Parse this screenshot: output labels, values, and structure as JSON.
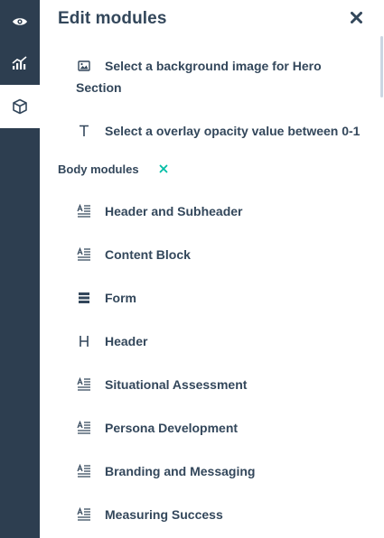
{
  "rail": {
    "items": [
      {
        "icon": "eye-icon",
        "active": false
      },
      {
        "icon": "chart-icon",
        "active": false
      },
      {
        "icon": "module-box-icon",
        "active": true
      }
    ]
  },
  "panel": {
    "title": "Edit modules",
    "close_icon": "close-icon"
  },
  "top_modules": [
    {
      "icon": "image-icon",
      "label_line1": "Select a background image for Hero",
      "label_line2": "Section"
    },
    {
      "icon": "text-icon",
      "label": "Select a overlay opacity value between 0-1"
    }
  ],
  "body_section": {
    "title": "Body modules",
    "action_icon": "collapse-x-icon",
    "accent": "#00bda5"
  },
  "body_modules": [
    {
      "icon": "rich-text-icon",
      "label": "Header and Subheader"
    },
    {
      "icon": "rich-text-icon",
      "label": "Content Block"
    },
    {
      "icon": "form-icon",
      "label": "Form"
    },
    {
      "icon": "header-icon",
      "label": "Header"
    },
    {
      "icon": "rich-text-icon",
      "label": "Situational Assessment"
    },
    {
      "icon": "rich-text-icon",
      "label": "Persona Development"
    },
    {
      "icon": "rich-text-icon",
      "label": "Branding and Messaging"
    },
    {
      "icon": "rich-text-icon",
      "label": "Measuring Success"
    }
  ]
}
